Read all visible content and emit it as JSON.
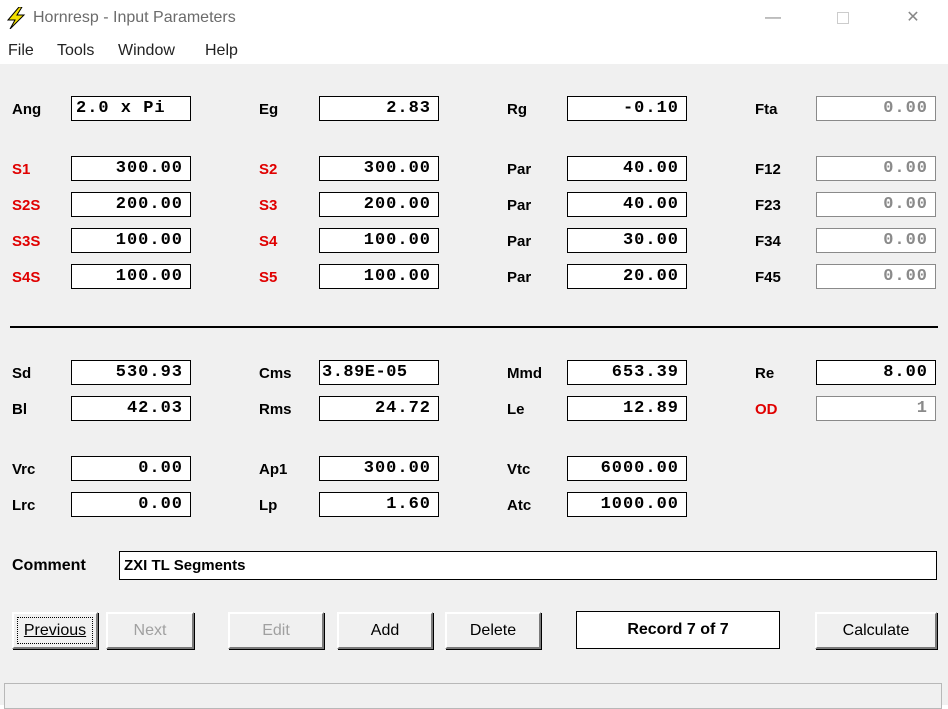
{
  "window": {
    "title": "Hornresp - Input Parameters"
  },
  "menu": [
    "File",
    "Tools",
    "Window",
    "Help"
  ],
  "labels": {
    "ang": "Ang",
    "eg": "Eg",
    "rg": "Rg",
    "fta": "Fta",
    "s1": "S1",
    "s2": "S2",
    "par1": "Par",
    "f12": "F12",
    "s2s": "S2S",
    "s3": "S3",
    "par2": "Par",
    "f23": "F23",
    "s3s": "S3S",
    "s4": "S4",
    "par3": "Par",
    "f34": "F34",
    "s4s": "S4S",
    "s5": "S5",
    "par4": "Par",
    "f45": "F45",
    "sd": "Sd",
    "cms": "Cms",
    "mmd": "Mmd",
    "re": "Re",
    "bl": "Bl",
    "rms": "Rms",
    "le": "Le",
    "od": "OD",
    "vrc": "Vrc",
    "ap1": "Ap1",
    "vtc": "Vtc",
    "lrc": "Lrc",
    "lp": "Lp",
    "atc": "Atc",
    "comment": "Comment"
  },
  "values": {
    "ang": "2.0 x Pi",
    "eg": "2.83",
    "rg": "-0.10",
    "fta": "0.00",
    "s1": "300.00",
    "s2": "300.00",
    "par1": "40.00",
    "f12": "0.00",
    "s2s": "200.00",
    "s3": "200.00",
    "par2": "40.00",
    "f23": "0.00",
    "s3s": "100.00",
    "s4": "100.00",
    "par3": "30.00",
    "f34": "0.00",
    "s4s": "100.00",
    "s5": "100.00",
    "par4": "20.00",
    "f45": "0.00",
    "sd": "530.93",
    "cms": "3.89E-05",
    "mmd": "653.39",
    "re": "8.00",
    "bl": "42.03",
    "rms": "24.72",
    "le": "12.89",
    "od": "1",
    "vrc": "0.00",
    "ap1": "300.00",
    "vtc": "6000.00",
    "lrc": "0.00",
    "lp": "1.60",
    "atc": "1000.00"
  },
  "comment": "ZXI TL Segments",
  "buttons": {
    "previous": "Previous",
    "next": "Next",
    "edit": "Edit",
    "add": "Add",
    "delete": "Delete",
    "calculate": "Calculate"
  },
  "record": "Record 7 of 7",
  "colors": {
    "red_label": "#e00000",
    "background": "#f0f0f0"
  }
}
